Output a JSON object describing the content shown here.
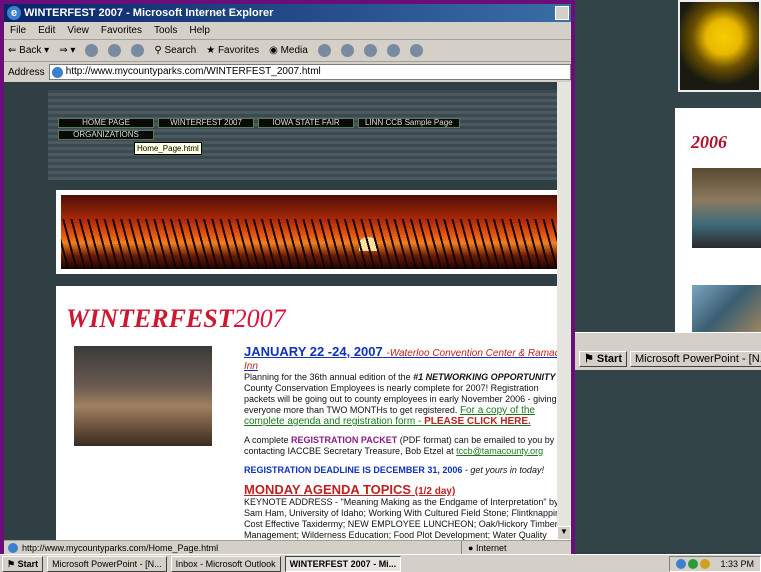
{
  "window": {
    "title": "WINTERFEST 2007 - Microsoft Internet Explorer"
  },
  "menu": [
    "File",
    "Edit",
    "View",
    "Favorites",
    "Tools",
    "Help"
  ],
  "toolbar": {
    "back": "Back",
    "search": "Search",
    "favorites": "Favorites",
    "media": "Media"
  },
  "address": {
    "label": "Address",
    "url": "http://www.mycountyparks.com/WINTERFEST_2007.html"
  },
  "nav": {
    "items": [
      "HOME PAGE",
      "WINTERFEST 2007",
      "IOWA STATE FAIR",
      "LINN CCB Sample Page",
      "ORGANIZATIONS"
    ],
    "tooltip": "Home_Page.html"
  },
  "content": {
    "title_main": "WINTERFEST",
    "title_year": "2007",
    "heading": "JANUARY 22 -24, 2007",
    "location": "-Waterloo Convention Center & Ramada Inn",
    "intro_a": "Planning for the 36th annual edition of the",
    "intro_emph": "#1 NETWORKING OPPORTUNITY",
    "intro_b": "for County Conservation Employees is nearly complete for 2007! Registration packets will be going out to county employees in early November 2006 - giving everyone more than TWO MONTHs to get registered.",
    "form_link": "For a copy of the complete agenda and registration form -",
    "form_click": "PLEASE CLICK HERE.",
    "packet_a": "A complete",
    "packet_b": "REGISTRATION PACKET",
    "packet_c": "(PDF format) can be emailed to you by contacting IACCBE Secretary Treasure, Bob Etzel at",
    "email": "tccb@tamacounty.org",
    "deadline": "REGISTRATION DEADLINE IS DECEMBER 31, 2006",
    "deadline_tail": "- get yours in today!",
    "monday": "MONDAY AGENDA TOPICS",
    "monday_small": "(1/2 day)",
    "monday_text": "KEYNOTE ADDRESS - \"Meaning Making as the Endgame of Interpretation\" by Sam Ham, University of Idaho; Working With Cultured Field Stone; Flintknapping; Cost Effective Taxidermy; NEW EMPLOYEE LUNCHEON; Oak/Hickory Timber Management; Wilderness Education; Food Plot Development; Water Quality Project Development; Introduction to Thematic Thinking; Youth Hunter Education Challenge; 2007 Farm Bill Wetland Restoration; EVENING ACTIVITIES - PowerPoint"
  },
  "status": {
    "url": "http://www.mycountyparks.com/Home_Page.html",
    "zone": "Internet"
  },
  "right": {
    "year_label": "2006"
  },
  "taskbar": {
    "start": "Start",
    "items": [
      "Microsoft PowerPoint - [N...",
      "Inbox - Microsoft Outlook",
      "WINTERFEST 2007 - Mi..."
    ],
    "time": "1:33 PM",
    "win2_item": "Microsoft PowerPoint - [N..."
  }
}
